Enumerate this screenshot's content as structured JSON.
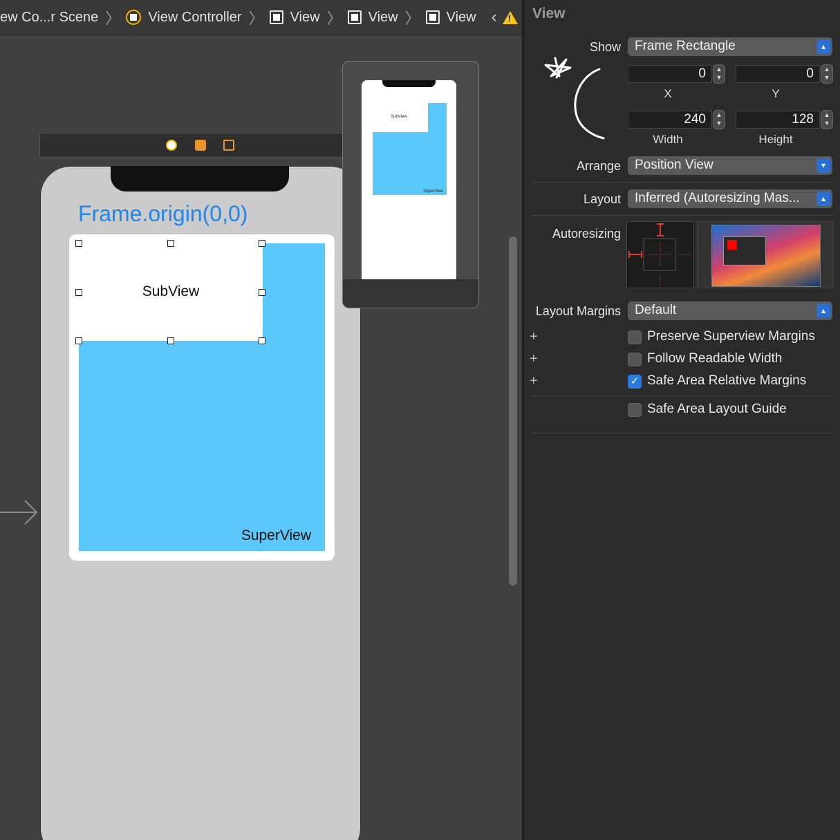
{
  "breadcrumb": {
    "scene": "ew Co...r Scene",
    "view_controller": "View Controller",
    "view1": "View",
    "view2": "View",
    "view3": "View"
  },
  "canvas": {
    "frame_label": "Frame.origin(0,0)",
    "subview_label": "SubView",
    "superview_label": "SuperView",
    "preview_subview_label": "SubView",
    "preview_superview_label": "SuperView"
  },
  "inspector": {
    "title": "View",
    "show_label": "Show",
    "show_value": "Frame Rectangle",
    "x_value": "0",
    "y_value": "0",
    "x_caption": "X",
    "y_caption": "Y",
    "width_value": "240",
    "height_value": "128",
    "width_caption": "Width",
    "height_caption": "Height",
    "arrange_label": "Arrange",
    "arrange_value": "Position View",
    "layout_label": "Layout",
    "layout_value": "Inferred (Autoresizing Mas...",
    "autoresizing_label": "Autoresizing",
    "layout_margins_label": "Layout Margins",
    "layout_margins_value": "Default",
    "checkboxes": [
      {
        "label": "Preserve Superview Margins",
        "checked": false
      },
      {
        "label": "Follow Readable Width",
        "checked": false
      },
      {
        "label": "Safe Area Relative Margins",
        "checked": true
      }
    ],
    "safe_area_guide_label": "Safe Area Layout Guide"
  },
  "colors": {
    "superview": "#5ac8fa",
    "frame_label": "#1e86ef",
    "accent": "#2a7ae2"
  }
}
